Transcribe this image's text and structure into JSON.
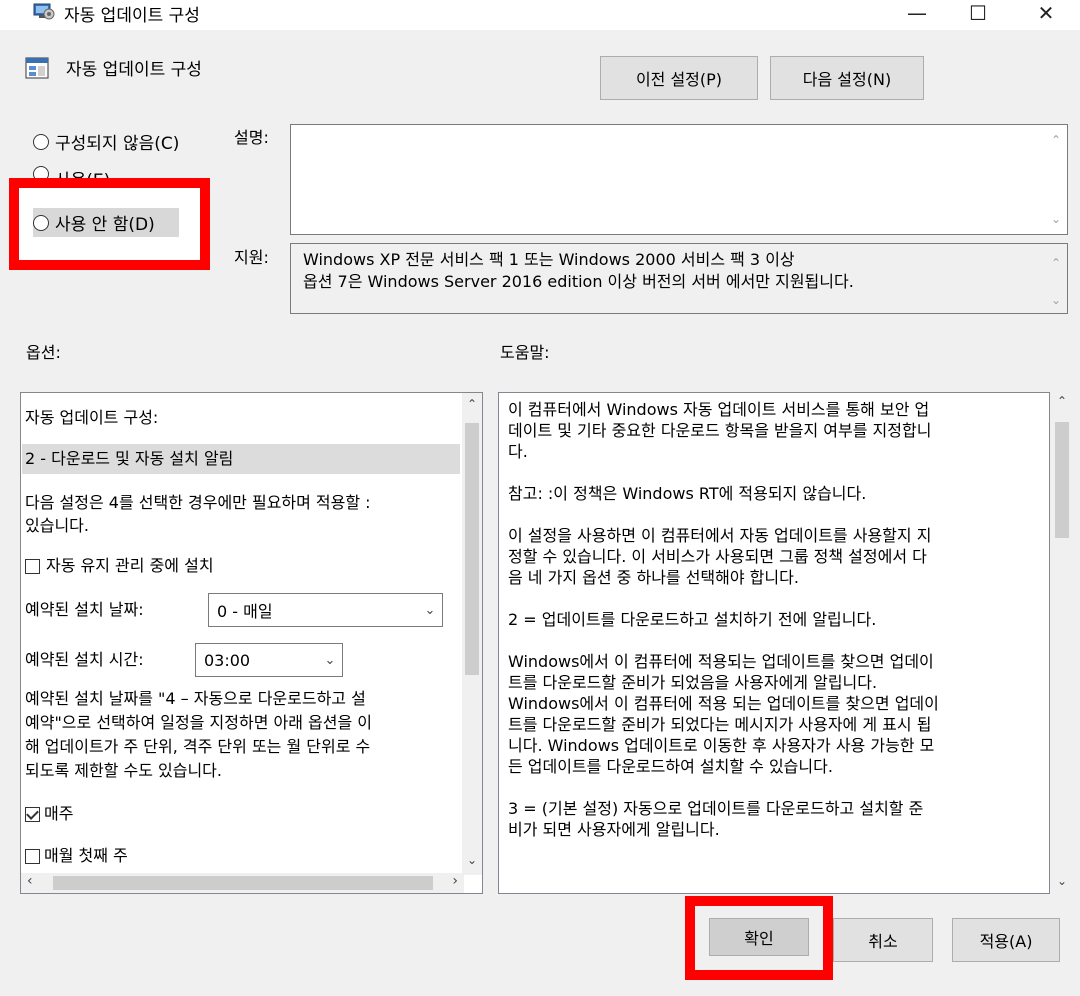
{
  "window": {
    "title": "자동 업데이트 구성",
    "icon": "policy-window-icon",
    "controls": {
      "minimize": "—",
      "maximize": "☐",
      "close": "✕"
    }
  },
  "header": {
    "title": "자동 업데이트 구성",
    "icon": "policy-setting-icon",
    "prev_button": "이전 설정(P)",
    "next_button": "다음 설정(N)"
  },
  "state": {
    "options": [
      {
        "label": "구성되지 않음(C)",
        "selected": false
      },
      {
        "label": "사용(E)",
        "selected": false
      },
      {
        "label": "사용 안 함(D)",
        "selected": false
      }
    ]
  },
  "description": {
    "label": "설명:",
    "text": ""
  },
  "supported": {
    "label": "지원:",
    "lines": [
      "Windows XP 전문 서비스 팩 1 또는 Windows 2000 서비스 팩 3 이상",
      "옵션 7은 Windows Server 2016 edition 이상 버전의 서버 에서만 지원됩니다."
    ]
  },
  "options_panel": {
    "label": "옵션:",
    "configure_label": "자동 업데이트 구성:",
    "selected_value": "2 - 다운로드 및 자동 설치 알림",
    "note_line1": "다음 설정은 4를 선택한 경우에만 필요하며 적용할 :",
    "note_line2": "있습니다.",
    "install_maintenance": "자동 유지 관리 중에 설치",
    "schedule_day_label": "예약된 설치 날짜:",
    "schedule_day_value": "0 - 매일",
    "schedule_time_label": "예약된 설치 시간:",
    "schedule_time_value": "03:00",
    "info_lines": [
      "예약된 설치 날짜를 \"4 – 자동으로 다운로드하고 설",
      "예약\"으로 선택하여 일정을 지정하면 아래 옵션을 이",
      "해 업데이트가 주 단위, 격주 단위 또는 월 단위로 수",
      "되도록 제한할 수도 있습니다."
    ],
    "weekly_label": "매주",
    "weekly_checked": true,
    "first_week_label": "매월 첫째 주",
    "first_week_checked": false
  },
  "help_panel": {
    "label": "도움말:",
    "paragraphs": [
      [
        "이 컴퓨터에서 Windows 자동 업데이트 서비스를 통해 보안 업",
        "데이트 및 기타 중요한 다운로드 항목을 받을지 여부를 지정합니",
        "다."
      ],
      [
        "참고: :이 정책은 Windows RT에 적용되지 않습니다."
      ],
      [
        "이 설정을 사용하면 이 컴퓨터에서 자동 업데이트를 사용할지 지",
        "정할 수 있습니다. 이 서비스가 사용되면 그룹 정책 설정에서 다",
        "음 네 가지 옵션 중 하나를 선택해야 합니다."
      ],
      [
        " 2 = 업데이트를 다운로드하고 설치하기 전에 알립니다."
      ],
      [
        " Windows에서 이 컴퓨터에 적용되는 업데이트를 찾으면 업데이",
        "트를 다운로드할 준비가 되었음을 사용자에게 알립니다.",
        "Windows에서 이 컴퓨터에 적용 되는 업데이트를 찾으면 업데이",
        "트를 다운로드할 준비가 되었다는 메시지가 사용자에 게 표시 됩",
        "니다. Windows 업데이트로 이동한 후 사용자가 사용 가능한 모",
        "든 업데이트를 다운로드하여 설치할 수 있습니다."
      ],
      [
        " 3 = (기본 설정) 자동으로 업데이트를 다운로드하고 설치할 준",
        "비가 되면 사용자에게 알립니다."
      ]
    ]
  },
  "footer": {
    "ok": "확인",
    "cancel": "취소",
    "apply": "적용(A)"
  },
  "annotation_color": "#ff0000"
}
